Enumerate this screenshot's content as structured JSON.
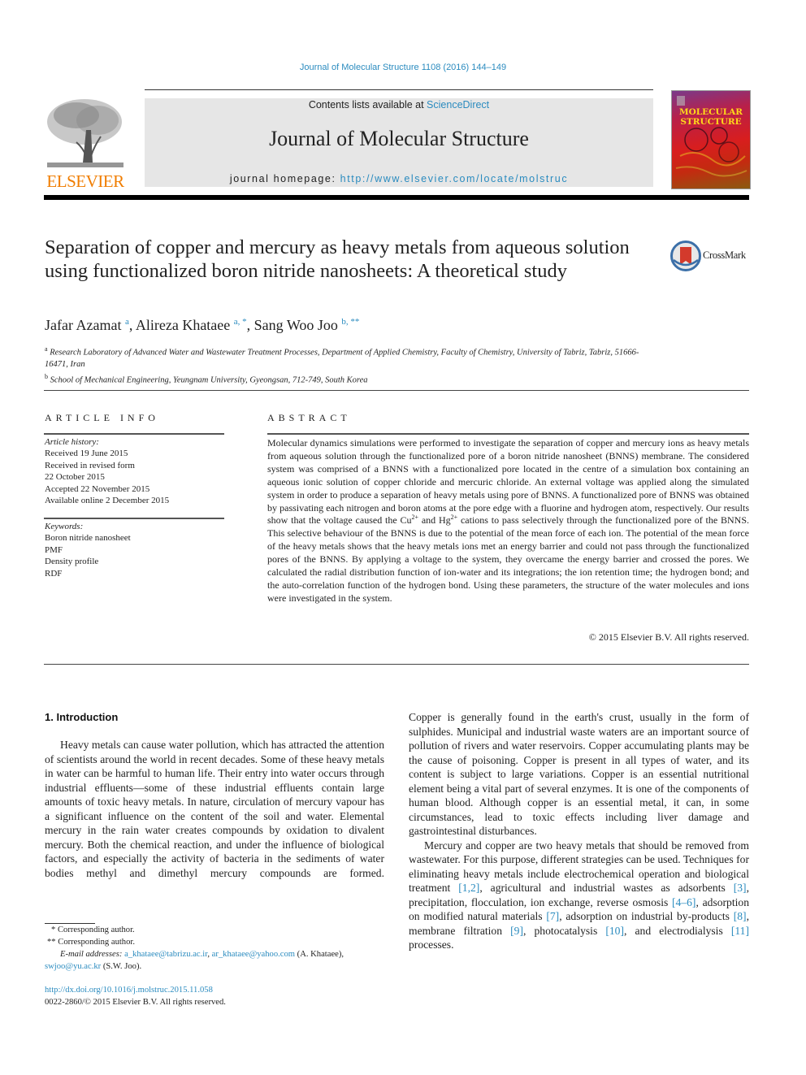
{
  "citation": "Journal of Molecular Structure 1108 (2016) 144–149",
  "masthead": {
    "contents_prefix": "Contents lists available at ",
    "contents_link": "ScienceDirect",
    "journal_title": "Journal of Molecular Structure",
    "homepage_prefix": "journal homepage: ",
    "homepage_link": "http://www.elsevier.com/locate/molstruc",
    "publisher_logo": "ELSEVIER",
    "cover_title_line1": "MOLECULAR",
    "cover_title_line2": "STRUCTURE"
  },
  "colors": {
    "link": "#2a8bbf",
    "elsevier_orange": "#f07d00",
    "masthead_bg": "#e6e6e6"
  },
  "article": {
    "title": "Separation of copper and mercury as heavy metals from aqueous solution using functionalized boron nitride nanosheets: A theoretical study",
    "crossmark_label": "CrossMark",
    "authors": [
      {
        "name": "Jafar Azamat",
        "sup": "a"
      },
      {
        "name": "Alireza Khataee",
        "sup": "a, *"
      },
      {
        "name": "Sang Woo Joo",
        "sup": "b, **"
      }
    ],
    "affiliations": [
      {
        "mark": "a",
        "text": "Research Laboratory of Advanced Water and Wastewater Treatment Processes, Department of Applied Chemistry, Faculty of Chemistry, University of Tabriz, Tabriz, 51666-16471, Iran"
      },
      {
        "mark": "b",
        "text": "School of Mechanical Engineering, Yeungnam University, Gyeongsan, 712-749, South Korea"
      }
    ]
  },
  "article_info": {
    "heading": "ARTICLE INFO",
    "history_label": "Article history:",
    "history": [
      "Received 19 June 2015",
      "Received in revised form",
      "22 October 2015",
      "Accepted 22 November 2015",
      "Available online 2 December 2015"
    ],
    "keywords_label": "Keywords:",
    "keywords": [
      "Boron nitride nanosheet",
      "PMF",
      "Density profile",
      "RDF"
    ]
  },
  "abstract": {
    "heading": "ABSTRACT",
    "text_part1": "Molecular dynamics simulations were performed to investigate the separation of copper and mercury ions as heavy metals from aqueous solution through the functionalized pore of a boron nitride nanosheet (BNNS) membrane. The considered system was comprised of a BNNS with a functionalized pore located in the centre of a simulation box containing an aqueous ionic solution of copper chloride and mercuric chloride. An external voltage was applied along the simulated system in order to produce a separation of heavy metals using pore of BNNS. A functionalized pore of BNNS was obtained by passivating each nitrogen and boron atoms at the pore edge with a fluorine and hydrogen atom, respectively. Our results show that the voltage caused the Cu",
    "sup1": "2+",
    "text_part2": " and Hg",
    "sup2": "2+",
    "text_part3": " cations to pass selectively through the functionalized pore of the BNNS. This selective behaviour of the BNNS is due to the potential of the mean force of each ion. The potential of the mean force of the heavy metals shows that the heavy metals ions met an energy barrier and could not pass through the functionalized pores of the BNNS. By applying a voltage to the system, they overcame the energy barrier and crossed the pores. We calculated the radial distribution function of ion-water and its integrations; the ion retention time; the hydrogen bond; and the auto-correlation function of the hydrogen bond. Using these parameters, the structure of the water molecules and ions were investigated in the system.",
    "copyright": "© 2015 Elsevier B.V. All rights reserved."
  },
  "body": {
    "section_heading": "1.  Introduction",
    "left_para": "Heavy metals can cause water pollution, which has attracted the attention of scientists around the world in recent decades. Some of these heavy metals in water can be harmful to human life. Their entry into water occurs through industrial effluents—some of these industrial effluents contain large amounts of toxic heavy metals. In nature, circulation of mercury vapour has a significant influence on the content of the soil and water. Elemental mercury in the rain water creates compounds by oxidation to divalent mercury. Both the chemical reaction, and under the influence of biological factors, and especially the activity of bacteria in the sediments of water bodies methyl and dimethyl mercury compounds are formed.",
    "right_para1": "Copper is generally found in the earth's crust, usually in the form of sulphides. Municipal and industrial waste waters are an important source of pollution of rivers and water reservoirs. Copper accumulating plants may be the cause of poisoning. Copper is present in all types of water, and its content is subject to large variations. Copper is an essential nutritional element being a vital part of several enzymes. It is one of the components of human blood. Although copper is an essential metal, it can, in some circumstances, lead to toxic effects including liver damage and gastrointestinal disturbances.",
    "right_para2": {
      "t1": "Mercury and copper are two heavy metals that should be removed from wastewater. For this purpose, different strategies can be used. Techniques for eliminating heavy metals include electrochemical operation and biological treatment ",
      "r1": "[1,2]",
      "t2": ", agricultural and industrial wastes as adsorbents ",
      "r2": "[3]",
      "t3": ", precipitation, flocculation, ion exchange, reverse osmosis ",
      "r3": "[4–6]",
      "t4": ", adsorption on modified natural materials ",
      "r4": "[7]",
      "t5": ", adsorption on industrial by-products ",
      "r5": "[8]",
      "t6": ", membrane filtration ",
      "r6": "[9]",
      "t7": ", photocatalysis ",
      "r7": "[10]",
      "t8": ", and electrodialysis ",
      "r8": "[11]",
      "t9": " processes."
    }
  },
  "footnotes": {
    "fn1_mark": "*",
    "fn1_text": "Corresponding author.",
    "fn2_mark": "**",
    "fn2_text": "Corresponding author.",
    "email_label": "E-mail addresses:",
    "email1": "a_khataee@tabrizu.ac.ir",
    "email2": "ar_khataee@yahoo.com",
    "email2_owner": " (A. Khataee),",
    "email3": "swjoo@yu.ac.kr",
    "email3_owner": " (S.W. Joo).",
    "doi": "http://dx.doi.org/10.1016/j.molstruc.2015.11.058",
    "issn_line": "0022-2860/© 2015 Elsevier B.V. All rights reserved."
  }
}
